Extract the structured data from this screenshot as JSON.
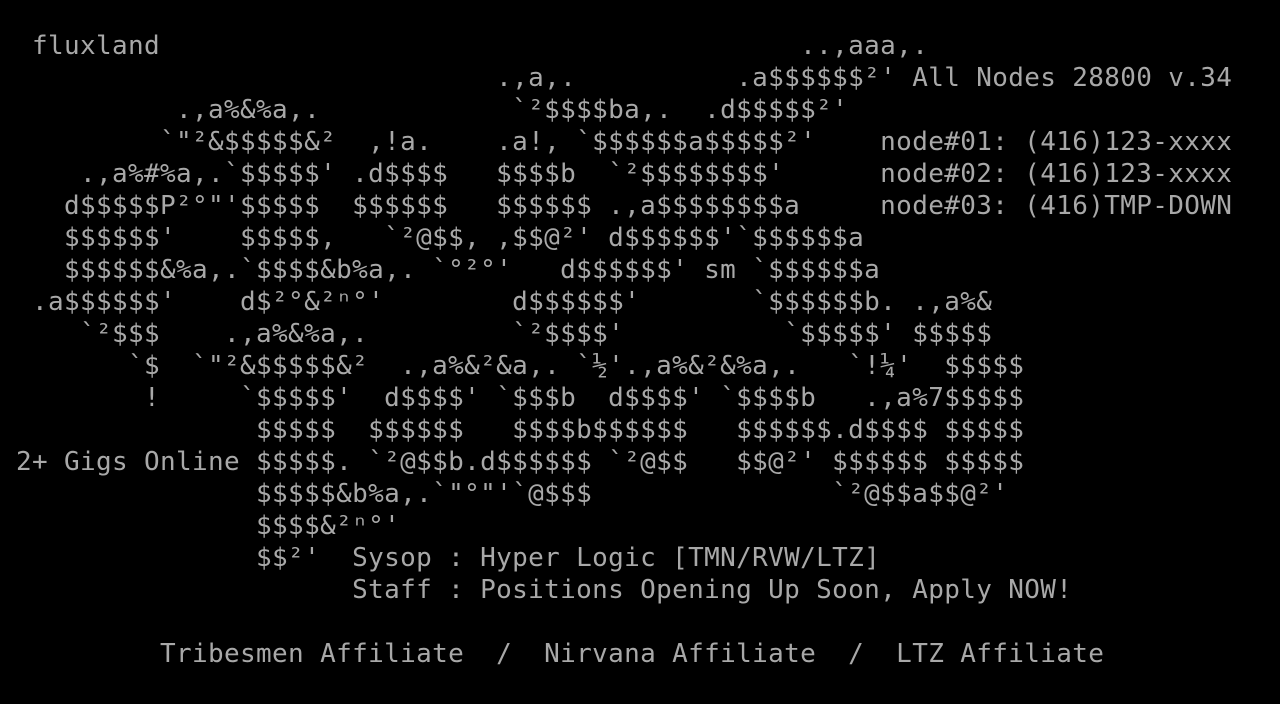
{
  "screen": {
    "rows": [
      "  fluxland                                        ..,aaa,.",
      "                               .,a,.          .a$$$$$$²' All Nodes 28800 v.34",
      "           .,a%&%a,.            `²$$$$ba,.  .d$$$$$²'",
      "          `\"²&$$$$$&²  ,!a.    .a!, `$$$$$$a$$$$$²'    node#01: (416)123-xxxx",
      "     .,a%#%a,.`$$$$$' .d$$$$   $$$$b  `²$$$$$$$$'      node#02: (416)123-xxxx",
      "    d$$$$$P²°\"'$$$$$  $$$$$$   $$$$$$ .,a$$$$$$$$a     node#03: (416)TMP-DOWN",
      "    $$$$$$'    $$$$$,   `²@$$, ,$$@²' d$$$$$$'`$$$$$$a",
      "    $$$$$$&%a,.`$$$$&b%a,. `°²°'   d$$$$$$' sm `$$$$$$a",
      "  .a$$$$$$'    d$²°&²ⁿ°'        d$$$$$$'       `$$$$$$b. .,a%&",
      "     `²$$$    .,a%&%a,.         `²$$$$'          `$$$$$' $$$$$",
      "        `$  `\"²&$$$$$&²  .,a%&²&a,. `½'.,a%&²&%a,.   `!¼'  $$$$$",
      "         !     `$$$$$'  d$$$$' `$$$b  d$$$$' `$$$$b   .,a%7$$$$$",
      "                $$$$$  $$$$$$   $$$$b$$$$$$   $$$$$$.d$$$$ $$$$$",
      " 2+ Gigs Online $$$$$. `²@$$b.d$$$$$$ `²@$$   $$@²' $$$$$$ $$$$$",
      "                $$$$$&b%a,.`\"°\"'`@$$$               `²@$$a$$@²'",
      "                $$$$&²ⁿ°'",
      "                $$²'  Sysop : Hyper Logic [TMN/RVW/LTZ]",
      "                      Staff : Positions Opening Up Soon, Apply NOW!",
      "",
      "          Tribesmen Affiliate  /  Nirvana Affiliate  /  LTZ Affiliate",
      ""
    ]
  },
  "colors": {
    "background": "#000000",
    "foreground": "#a8a8a8"
  }
}
